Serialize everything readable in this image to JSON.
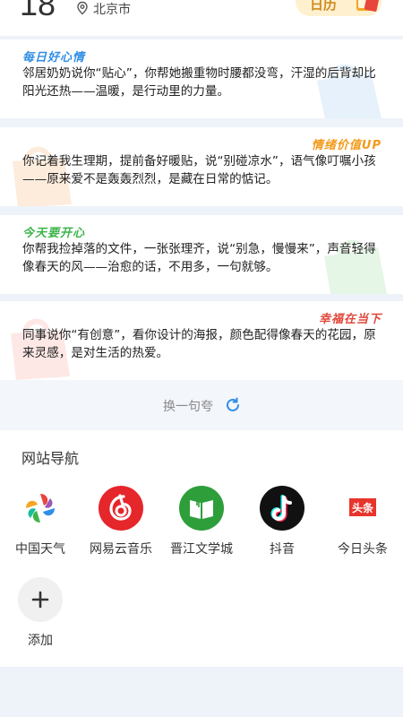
{
  "header": {
    "day": "18",
    "location": "北京市",
    "calendar_label": "日历"
  },
  "cards": [
    {
      "tag": "每日好心情",
      "tag_color": "#2f8ee6",
      "text": "邻居奶奶说你“贴心”，你帮她搬重物时腰都没弯，汗湿的后背却比阳光还热——温暖，是行动里的力量。"
    },
    {
      "tag": "情绪价值UP",
      "tag_color": "#f29a1a",
      "text": "你记着我生理期，提前备好暖贴，说“别碰凉水”，语气像叮嘱小孩——原来爱不是轰轰烈烈，是藏在日常的惦记。"
    },
    {
      "tag": "今天要开心",
      "tag_color": "#3cb54a",
      "text": "你帮我捡掉落的文件，一张张理齐，说“别急，慢慢来”，声音轻得像春天的风——治愈的话，不用多，一句就够。"
    },
    {
      "tag": "幸福在当下",
      "tag_color": "#e0483c",
      "text": "同事说你“有创意”，看你设计的海报，颜色配得像春天的花园，原来灵感，是对生活的热爱。"
    }
  ],
  "swap": {
    "label": "换一句夸"
  },
  "nav": {
    "title": "网站导航",
    "items": [
      {
        "label": "中国天气",
        "icon": "china-weather-icon"
      },
      {
        "label": "网易云音乐",
        "icon": "netease-music-icon"
      },
      {
        "label": "晋江文学城",
        "icon": "jjwxc-icon"
      },
      {
        "label": "抖音",
        "icon": "douyin-icon"
      },
      {
        "label": "今日头条",
        "icon": "toutiao-icon",
        "icon_text": "头条"
      }
    ],
    "add_label": "添加"
  },
  "colors": {
    "accent_blue": "#2f8ee6",
    "netease_red": "#e5262b",
    "jjwxc_green": "#2e9e3a",
    "toutiao_red": "#e8342c"
  }
}
